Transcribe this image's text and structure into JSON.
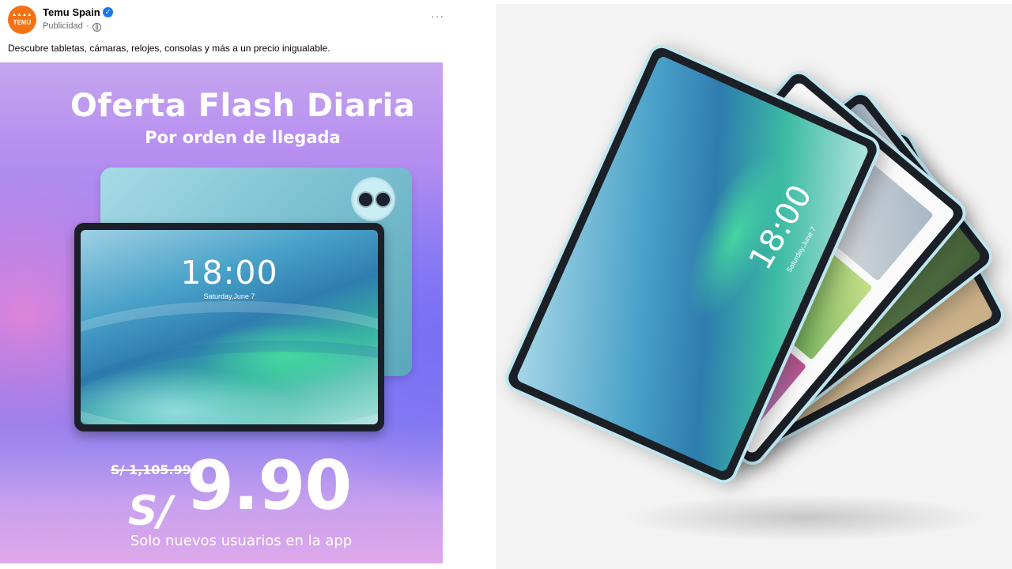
{
  "post": {
    "page_name": "Temu Spain",
    "avatar_top": "▲▲▲▲",
    "avatar_bottom": "TEMU",
    "sponsored_label": "Publicidad",
    "sponsored_separator": "·",
    "more_options": "···",
    "caption": "Descubre tabletas, cámaras, relojes, consolas y más a un precio inigualable."
  },
  "ad": {
    "title": "Oferta Flash Diaria",
    "subtitle": "Por orden de llegada",
    "screen_time": "18:00",
    "screen_date": "Saturday,June 7",
    "old_price": "S/ 1,105.99",
    "currency": "S/",
    "price": "9.90",
    "footer": "Solo nuevos usuarios en la app"
  },
  "product_image": {
    "screen_time": "18:00",
    "screen_date": "Saturday,June 7"
  },
  "colors": {
    "brand": "#f47216",
    "verified": "#1877f2",
    "tablet_frame": "#bfe6f0"
  },
  "icons": [
    "verified-badge-icon",
    "globe-icon",
    "more-options-icon"
  ]
}
